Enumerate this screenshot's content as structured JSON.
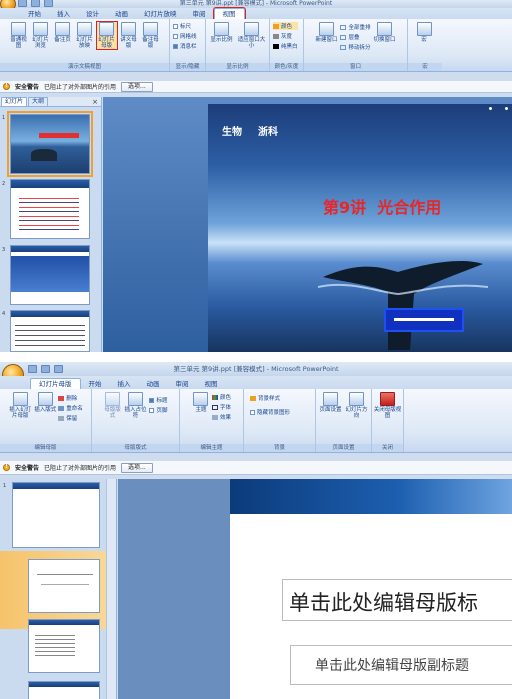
{
  "shot1": {
    "title": "第三单元 第9讲.ppt [兼容模式] - Microsoft PowerPoint",
    "tabs": [
      "开始",
      "插入",
      "设计",
      "动画",
      "幻灯片放映",
      "审阅",
      "视图"
    ],
    "active_tab": "视图",
    "groups": [
      {
        "label": "演示文稿视图",
        "buttons": [
          "普通视图",
          "幻灯片浏览",
          "备注页",
          "幻灯片放映",
          "幻灯片母版",
          "讲义母版",
          "备注母版"
        ]
      },
      {
        "label": "显示/隐藏",
        "items": [
          "标尺",
          "网格线",
          "消息栏"
        ]
      },
      {
        "label": "显示比例",
        "buttons": [
          "显示比例",
          "适应窗口大小"
        ]
      },
      {
        "label": "颜色/灰度",
        "items": [
          "颜色",
          "灰度",
          "纯黑白"
        ]
      },
      {
        "label": "窗口",
        "buttons": [
          "新建窗口",
          "全部重排",
          "层叠",
          "移动拆分",
          "切换窗口"
        ]
      },
      {
        "label": "宏",
        "buttons": [
          "宏"
        ]
      }
    ],
    "security_warning": "安全警告",
    "security_msg": "已阻止了对外部图片的引用",
    "options_btn": "选项...",
    "pane_tabs": [
      "幻灯片",
      "大纲"
    ],
    "thumb_nums": [
      "1",
      "2",
      "3",
      "4"
    ],
    "slide_subject": "生物",
    "slide_publisher": "浙科",
    "slide_title": "第9讲  光合作用"
  },
  "shot2": {
    "title": "第三单元 第9讲.ppt [兼容模式] - Microsoft PowerPoint",
    "tabs": [
      "幻灯片母版",
      "开始",
      "插入",
      "动画",
      "审阅",
      "视图"
    ],
    "active_tab": "幻灯片母版",
    "groups": [
      {
        "label": "编辑母版",
        "buttons": [
          "插入幻灯片母版",
          "插入版式",
          "删除",
          "重命名",
          "保留"
        ]
      },
      {
        "label": "母版版式",
        "buttons": [
          "母版版式",
          "插入占位符",
          "标题",
          "页脚"
        ]
      },
      {
        "label": "编辑主题",
        "buttons": [
          "主题",
          "颜色",
          "字体",
          "效果"
        ]
      },
      {
        "label": "背景",
        "buttons": [
          "背景样式",
          "隐藏背景图形"
        ]
      },
      {
        "label": "页面设置",
        "buttons": [
          "页面设置",
          "幻灯片方向"
        ]
      },
      {
        "label": "关闭",
        "buttons": [
          "关闭母版视图"
        ]
      }
    ],
    "security_warning": "安全警告",
    "security_msg": "已阻止了对外部图片的引用",
    "options_btn": "选项...",
    "thumb_num": "1",
    "master_title": "单击此处编辑母版标",
    "master_subtitle": "单击此处编辑母版副标题"
  }
}
